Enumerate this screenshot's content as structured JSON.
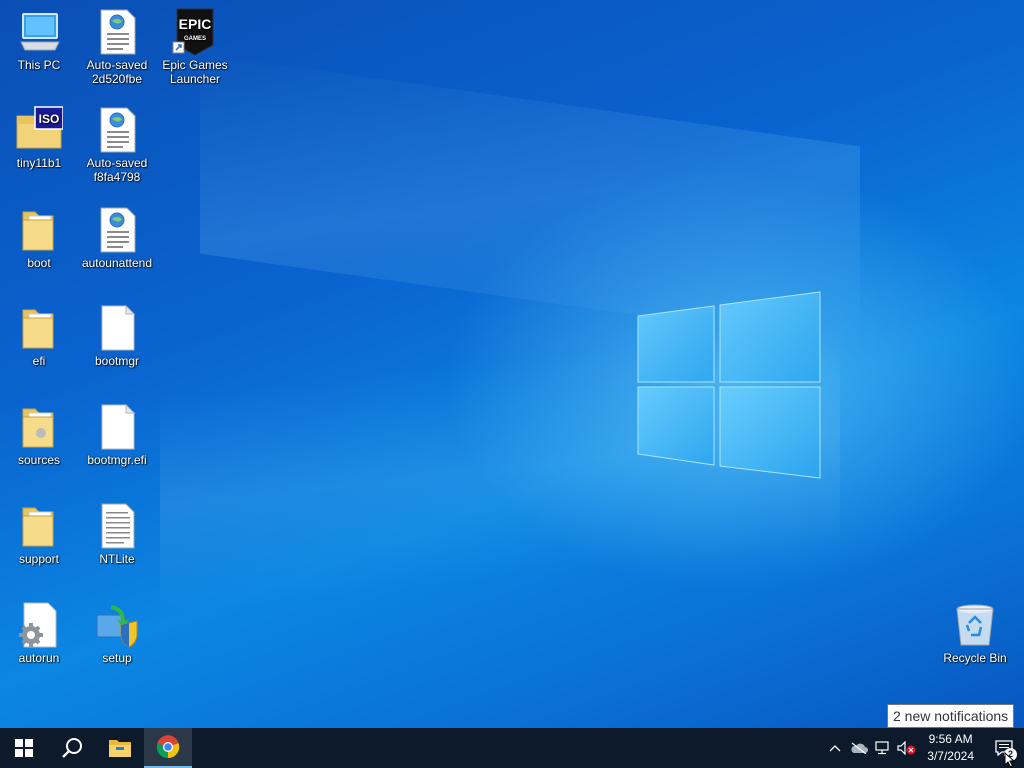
{
  "desktop": {
    "icons": [
      {
        "label": "This PC"
      },
      {
        "label": "Auto-saved 2d520fbe"
      },
      {
        "label": "Epic Games Launcher",
        "logo_top": "EPIC",
        "logo_bottom": "GAMES"
      },
      {
        "label": "tiny11b1",
        "badge": "ISO"
      },
      {
        "label": "Auto-saved f8fa4798"
      },
      {
        "label": "boot"
      },
      {
        "label": "autounattend"
      },
      {
        "label": "efi"
      },
      {
        "label": "bootmgr"
      },
      {
        "label": "sources"
      },
      {
        "label": "bootmgr.efi"
      },
      {
        "label": "support"
      },
      {
        "label": "NTLite"
      },
      {
        "label": "autorun"
      },
      {
        "label": "setup"
      },
      {
        "label": "Recycle Bin"
      }
    ]
  },
  "taskbar": {
    "start_icon": "windows-logo-icon",
    "search_icon": "search-icon",
    "pinned": [
      {
        "name": "file-explorer-icon"
      },
      {
        "name": "chrome-icon",
        "active": true
      }
    ],
    "tray": {
      "clock_time": "9:56 AM",
      "clock_date": "3/7/2024",
      "notification_count": "2",
      "tooltip": "2 new notifications"
    }
  },
  "colors": {
    "taskbar_bg": "#0d1a2c",
    "desktop_blue": "#0a6fd6",
    "accent": "#76b9ed"
  }
}
